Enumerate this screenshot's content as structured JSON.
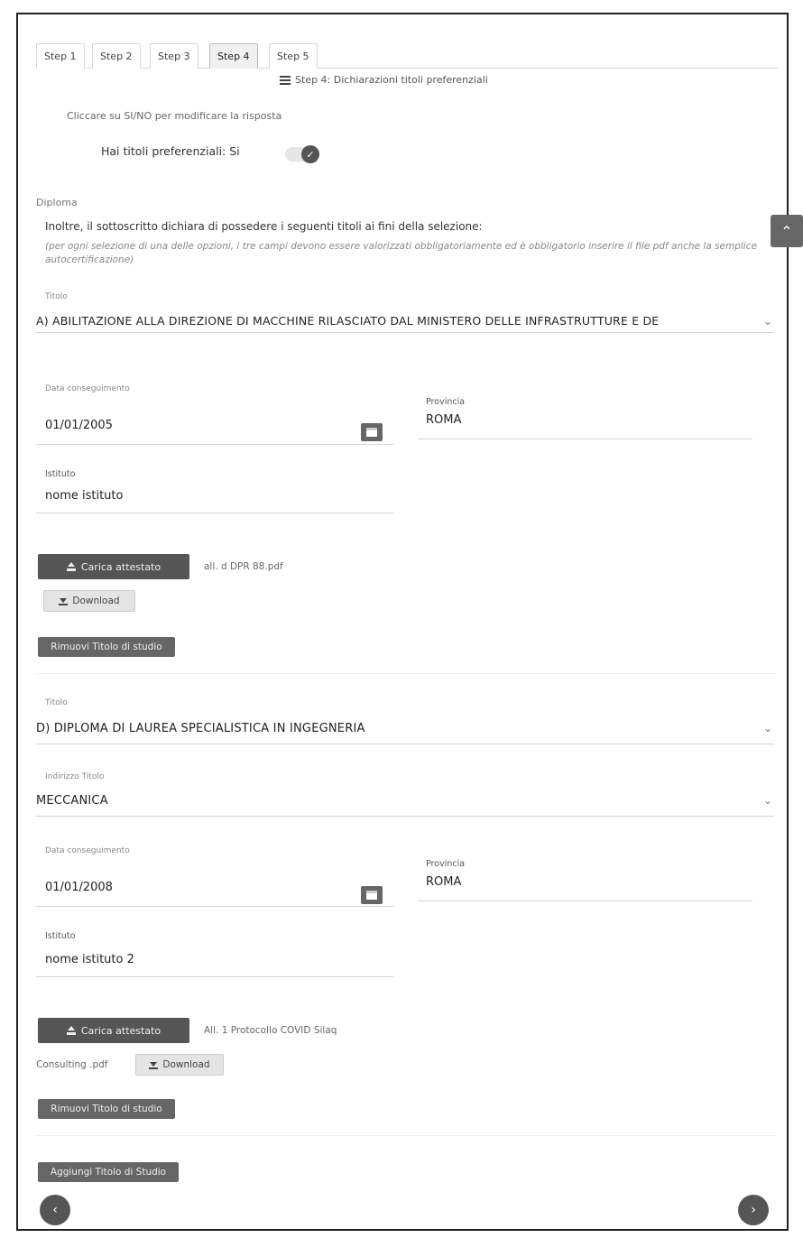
{
  "tabs": [
    {
      "label": "Step 1"
    },
    {
      "label": "Step 2"
    },
    {
      "label": "Step 3"
    },
    {
      "label": "Step 4",
      "active": true
    },
    {
      "label": "Step 5"
    }
  ],
  "step_title": "Step 4: Dichiarazioni titoli preferenziali",
  "hint": "Cliccare su SI/NO per modificare la risposta",
  "preferential": {
    "label": "Hai titoli preferenziali: Si",
    "value": true
  },
  "section_label": "Diploma",
  "intro": "Inoltre, il sottoscritto dichiara di possedere i seguenti titoli ai fini della selezione:",
  "note": "(per ogni selezione di una delle opzioni, i tre campi devono essere valorizzati obbligatoriamente ed è obbligatorio inserire il file pdf anche la semplice autocertificazione)",
  "titles": [
    {
      "titolo_label": "Titolo",
      "titolo_value": "A) ABILITAZIONE ALLA DIREZIONE DI MACCHINE RILASCIATO DAL MINISTERO DELLE INFRASTRUTTURE E DE",
      "data_label": "Data conseguimento",
      "data_value": "01/01/2005",
      "provincia_label": "Provincia",
      "provincia_value": "ROMA",
      "istituto_label": "Istituto",
      "istituto_value": "nome istituto",
      "upload_label": "Carica attestato",
      "file_name": "all. d DPR 88.pdf",
      "download_label": "Download",
      "remove_label": "Rimuovi Titolo di studio"
    },
    {
      "titolo_label": "Titolo",
      "titolo_value": "D) DIPLOMA DI LAUREA SPECIALISTICA IN INGEGNERIA",
      "indirizzo_label": "Indirizzo Titolo",
      "indirizzo_value": "MECCANICA",
      "data_label": "Data conseguimento",
      "data_value": "01/01/2008",
      "provincia_label": "Provincia",
      "provincia_value": "ROMA",
      "istituto_label": "Istituto",
      "istituto_value": "nome istituto 2",
      "upload_label": "Carica attestato",
      "file_name_1": "All. 1 Protocollo COVID Silaq",
      "file_name_2": "Consulting .pdf",
      "download_label": "Download",
      "remove_label": "Rimuovi Titolo di studio"
    }
  ],
  "add_label": "Aggiungi Titolo di Studio",
  "icons": {
    "prev": "chevron-left-icon",
    "next": "chevron-right-icon",
    "scroll_top": "chevron-up-icon",
    "calendar": "calendar-icon",
    "upload": "upload-icon",
    "download": "download-icon",
    "list": "list-icon",
    "check": "check-icon"
  }
}
